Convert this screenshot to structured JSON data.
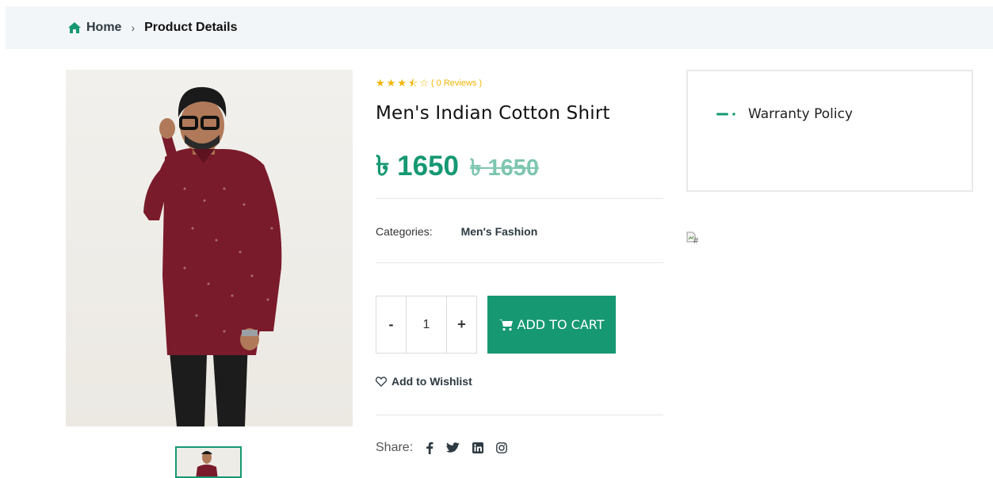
{
  "breadcrumb": {
    "home_label": "Home",
    "separator": "›",
    "current": "Product Details"
  },
  "product": {
    "rating": {
      "value": 3.5,
      "max": 5,
      "reviews_text": "( 0 Reviews )"
    },
    "title": "Men's Indian Cotton Shirt",
    "price": "৳ 1650",
    "old_price": "৳ 1650",
    "categories_label": "Categories:",
    "category": "Men's Fashion",
    "quantity": "1",
    "minus_label": "-",
    "plus_label": "+",
    "add_to_cart_label": "ADD TO CART",
    "wishlist_label": "Add to Wishlist",
    "share_label": "Share:"
  },
  "sidebar": {
    "warranty_label": "Warranty Policy",
    "broken_image_alt": "#"
  },
  "colors": {
    "accent": "#169873",
    "star": "#f4b400",
    "shirt": "#7a1b2b"
  },
  "icons": [
    "home-icon",
    "cart-icon",
    "heart-icon",
    "facebook-icon",
    "twitter-icon",
    "linkedin-icon",
    "instagram-icon"
  ]
}
